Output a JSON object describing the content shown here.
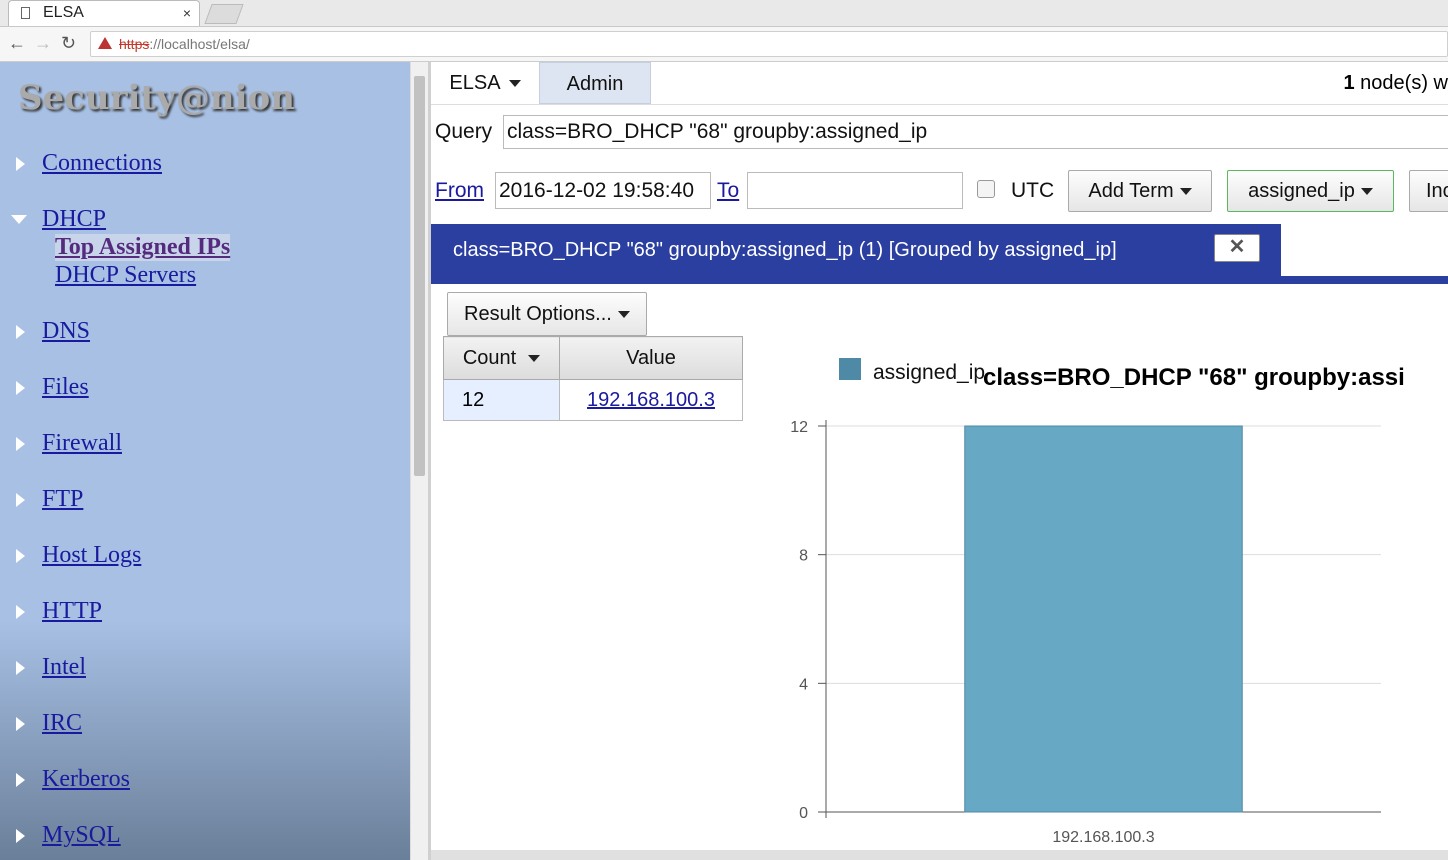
{
  "browser": {
    "tab_title": "ELSA",
    "tab_close": "×",
    "url_scheme": "https",
    "url_rest": "://localhost/elsa/"
  },
  "sidebar": {
    "logo": "Security@nion",
    "items": [
      {
        "label": "Connections"
      },
      {
        "label": "DHCP",
        "expanded": true,
        "children": [
          "Top Assigned IPs",
          "DHCP Servers"
        ]
      },
      {
        "label": "DNS"
      },
      {
        "label": "Files"
      },
      {
        "label": "Firewall"
      },
      {
        "label": "FTP"
      },
      {
        "label": "Host Logs"
      },
      {
        "label": "HTTP"
      },
      {
        "label": "Intel"
      },
      {
        "label": "IRC"
      },
      {
        "label": "Kerberos"
      },
      {
        "label": "MySQL"
      }
    ]
  },
  "topmenu": {
    "elsa": "ELSA",
    "admin": "Admin",
    "nodes_count": "1",
    "nodes_text": " node(s) w"
  },
  "query": {
    "label": "Query",
    "value": "class=BRO_DHCP \"68\" groupby:assigned_ip"
  },
  "range": {
    "from_label": "From",
    "from_value": "2016-12-02 19:58:40",
    "to_label": "To",
    "to_value": "",
    "utc_label": "UTC",
    "utc_checked": false
  },
  "buttons": {
    "add_term": "Add Term",
    "groupby": "assigned_ip",
    "index": "Inc"
  },
  "result_tab": {
    "label": "class=BRO_DHCP \"68\" groupby:assigned_ip (1) [Grouped by assigned_ip]",
    "close": "✕"
  },
  "result_options": "Result Options...",
  "table": {
    "headers": [
      "Count",
      "Value"
    ],
    "rows": [
      {
        "count": "12",
        "value": "192.168.100.3"
      }
    ]
  },
  "colors": {
    "tab_blue": "#2b3fa1",
    "bar": "#67a8c4",
    "sidebar": "#a7c0e4"
  },
  "chart_data": {
    "type": "bar",
    "title": "class=BRO_DHCP \"68\" groupby:assi",
    "categories": [
      "192.168.100.3"
    ],
    "series": [
      {
        "name": "assigned_ip",
        "values": [
          12
        ]
      }
    ],
    "ylim": [
      0,
      12
    ],
    "yticks": [
      "0",
      "4",
      "8",
      "12"
    ],
    "grid": true,
    "legend": "top-left"
  }
}
